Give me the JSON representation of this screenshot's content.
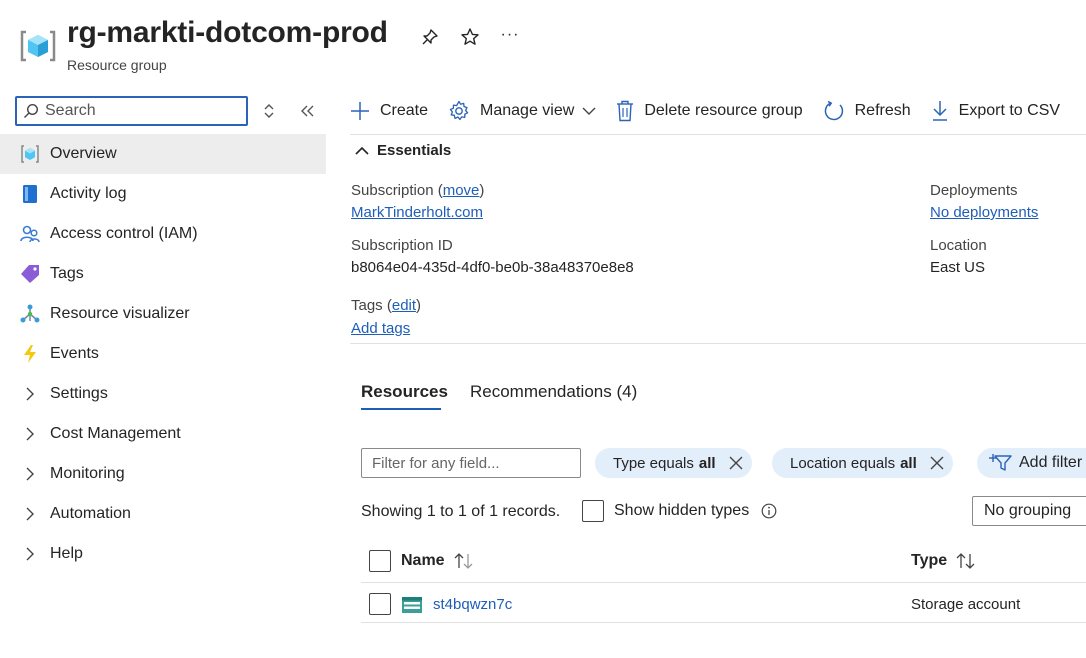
{
  "header": {
    "title": "rg-markti-dotcom-prod",
    "subtitle": "Resource group",
    "more_label": "···"
  },
  "sidebar": {
    "search_placeholder": "Search",
    "items": [
      {
        "label": "Overview",
        "icon": "resource-group-icon",
        "active": true
      },
      {
        "label": "Activity log",
        "icon": "activity-log-icon"
      },
      {
        "label": "Access control (IAM)",
        "icon": "iam-icon"
      },
      {
        "label": "Tags",
        "icon": "tag-icon"
      },
      {
        "label": "Resource visualizer",
        "icon": "visualizer-icon"
      },
      {
        "label": "Events",
        "icon": "lightning-icon"
      },
      {
        "label": "Settings",
        "icon": "chevron-right-icon"
      },
      {
        "label": "Cost Management",
        "icon": "chevron-right-icon"
      },
      {
        "label": "Monitoring",
        "icon": "chevron-right-icon"
      },
      {
        "label": "Automation",
        "icon": "chevron-right-icon"
      },
      {
        "label": "Help",
        "icon": "chevron-right-icon"
      }
    ]
  },
  "toolbar": {
    "create": "Create",
    "manage_view": "Manage view",
    "delete": "Delete resource group",
    "refresh": "Refresh",
    "export": "Export to CSV"
  },
  "essentials": {
    "toggle_label": "Essentials",
    "subscription_label": "Subscription (",
    "subscription_move": "move",
    "subscription_close": ")",
    "subscription_value": "MarkTinderholt.com",
    "subscription_id_label": "Subscription ID",
    "subscription_id_value": "b8064e04-435d-4df0-be0b-38a48370e8e8",
    "tags_label": "Tags (",
    "tags_edit": "edit",
    "tags_close": ")",
    "tags_add": "Add tags",
    "deployments_label": "Deployments",
    "deployments_value": "No deployments",
    "location_label": "Location",
    "location_value": "East US"
  },
  "tabs": {
    "resources": "Resources",
    "recommendations": "Recommendations (4)"
  },
  "filters": {
    "filter_placeholder": "Filter for any field...",
    "type_pill_prefix": "Type equals",
    "type_pill_value": "all",
    "location_pill_prefix": "Location equals",
    "location_pill_value": "all",
    "add_filter": "Add filter"
  },
  "list": {
    "showing": "Showing 1 to 1 of 1 records.",
    "show_hidden": "Show hidden types",
    "grouping": "No grouping",
    "col_name": "Name",
    "col_type": "Type",
    "rows": [
      {
        "name": "st4bqwzn7c",
        "type": "Storage account"
      }
    ]
  },
  "colors": {
    "accent": "#1f5eb8",
    "search_border": "#2a63b7",
    "pill_bg": "#e3eefb",
    "active_nav_bg": "#ededed"
  }
}
